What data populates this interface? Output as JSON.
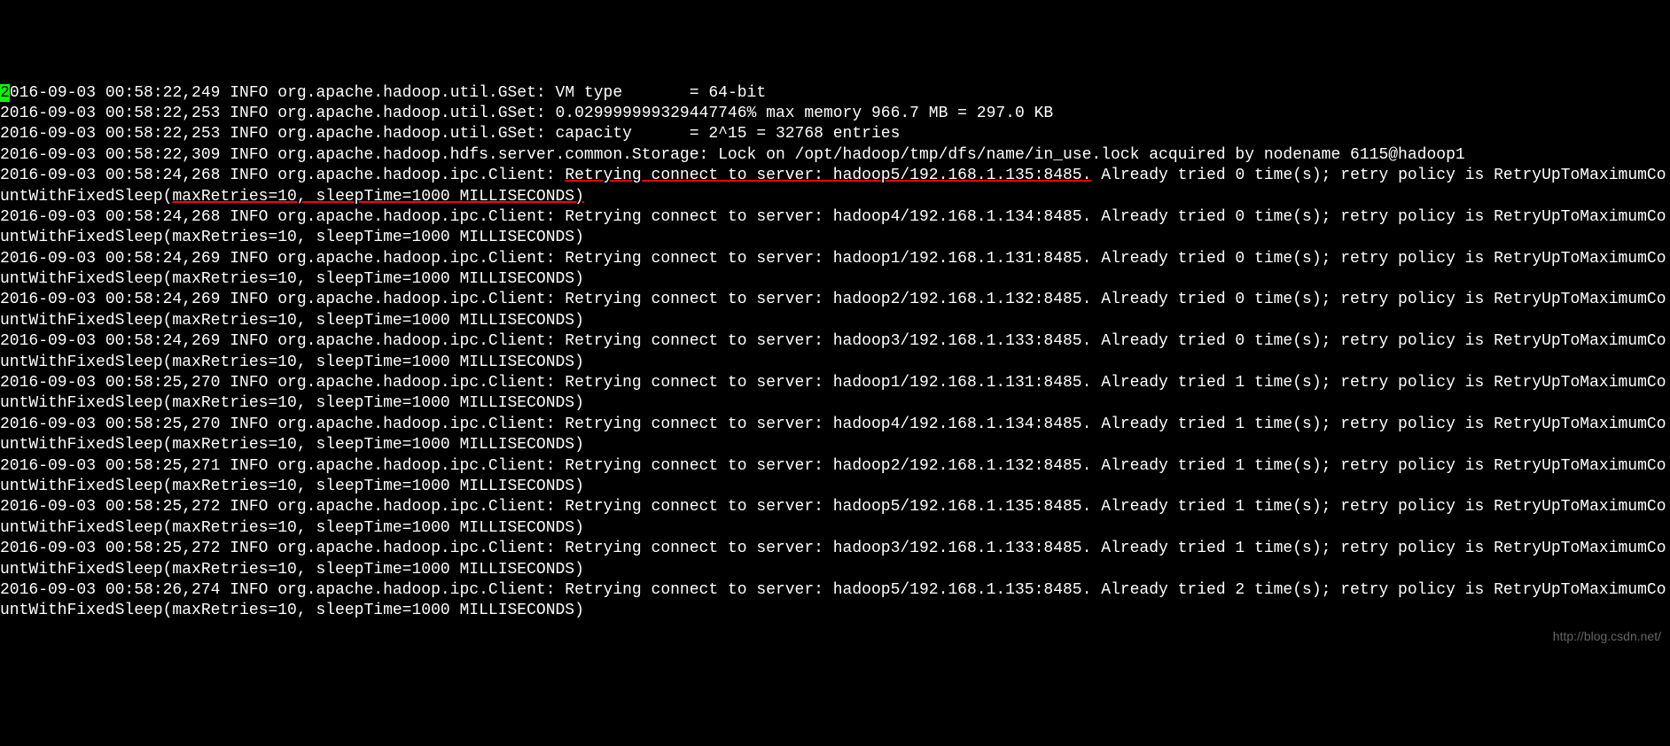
{
  "terminal": {
    "lines": [
      {
        "ts": "2016-09-03 00:58:22,249",
        "level": "INFO",
        "class": "org.apache.hadoop.util.GSet",
        "msg": "VM type       = 64-bit",
        "cursor": true
      },
      {
        "ts": "2016-09-03 00:58:22,253",
        "level": "INFO",
        "class": "org.apache.hadoop.util.GSet",
        "msg": "0.029999999329447746% max memory 966.7 MB = 297.0 KB"
      },
      {
        "ts": "2016-09-03 00:58:22,253",
        "level": "INFO",
        "class": "org.apache.hadoop.util.GSet",
        "msg": "capacity      = 2^15 = 32768 entries"
      },
      {
        "ts": "2016-09-03 00:58:22,309",
        "level": "INFO",
        "class": "org.apache.hadoop.hdfs.server.common.Storage",
        "msg": "Lock on /opt/hadoop/tmp/dfs/name/in_use.lock acquired by nodename 6115@hadoop1"
      },
      {
        "ts": "2016-09-03 00:58:24,268",
        "level": "INFO",
        "class": "org.apache.hadoop.ipc.Client",
        "msg": "Retrying connect to server: hadoop5/192.168.1.135:8485. Already tried 0 time(s); retry policy is RetryUpToMaximumCountWithFixedSleep(maxRetries=10, sleepTime=1000 MILLISECONDS)",
        "highlight": true
      },
      {
        "ts": "2016-09-03 00:58:24,268",
        "level": "INFO",
        "class": "org.apache.hadoop.ipc.Client",
        "msg": "Retrying connect to server: hadoop4/192.168.1.134:8485. Already tried 0 time(s); retry policy is RetryUpToMaximumCountWithFixedSleep(maxRetries=10, sleepTime=1000 MILLISECONDS)"
      },
      {
        "ts": "2016-09-03 00:58:24,269",
        "level": "INFO",
        "class": "org.apache.hadoop.ipc.Client",
        "msg": "Retrying connect to server: hadoop1/192.168.1.131:8485. Already tried 0 time(s); retry policy is RetryUpToMaximumCountWithFixedSleep(maxRetries=10, sleepTime=1000 MILLISECONDS)"
      },
      {
        "ts": "2016-09-03 00:58:24,269",
        "level": "INFO",
        "class": "org.apache.hadoop.ipc.Client",
        "msg": "Retrying connect to server: hadoop2/192.168.1.132:8485. Already tried 0 time(s); retry policy is RetryUpToMaximumCountWithFixedSleep(maxRetries=10, sleepTime=1000 MILLISECONDS)"
      },
      {
        "ts": "2016-09-03 00:58:24,269",
        "level": "INFO",
        "class": "org.apache.hadoop.ipc.Client",
        "msg": "Retrying connect to server: hadoop3/192.168.1.133:8485. Already tried 0 time(s); retry policy is RetryUpToMaximumCountWithFixedSleep(maxRetries=10, sleepTime=1000 MILLISECONDS)"
      },
      {
        "ts": "2016-09-03 00:58:25,270",
        "level": "INFO",
        "class": "org.apache.hadoop.ipc.Client",
        "msg": "Retrying connect to server: hadoop1/192.168.1.131:8485. Already tried 1 time(s); retry policy is RetryUpToMaximumCountWithFixedSleep(maxRetries=10, sleepTime=1000 MILLISECONDS)"
      },
      {
        "ts": "2016-09-03 00:58:25,270",
        "level": "INFO",
        "class": "org.apache.hadoop.ipc.Client",
        "msg": "Retrying connect to server: hadoop4/192.168.1.134:8485. Already tried 1 time(s); retry policy is RetryUpToMaximumCountWithFixedSleep(maxRetries=10, sleepTime=1000 MILLISECONDS)"
      },
      {
        "ts": "2016-09-03 00:58:25,271",
        "level": "INFO",
        "class": "org.apache.hadoop.ipc.Client",
        "msg": "Retrying connect to server: hadoop2/192.168.1.132:8485. Already tried 1 time(s); retry policy is RetryUpToMaximumCountWithFixedSleep(maxRetries=10, sleepTime=1000 MILLISECONDS)"
      },
      {
        "ts": "2016-09-03 00:58:25,272",
        "level": "INFO",
        "class": "org.apache.hadoop.ipc.Client",
        "msg": "Retrying connect to server: hadoop5/192.168.1.135:8485. Already tried 1 time(s); retry policy is RetryUpToMaximumCountWithFixedSleep(maxRetries=10, sleepTime=1000 MILLISECONDS)"
      },
      {
        "ts": "2016-09-03 00:58:25,272",
        "level": "INFO",
        "class": "org.apache.hadoop.ipc.Client",
        "msg": "Retrying connect to server: hadoop3/192.168.1.133:8485. Already tried 1 time(s); retry policy is RetryUpToMaximumCountWithFixedSleep(maxRetries=10, sleepTime=1000 MILLISECONDS)"
      },
      {
        "ts": "2016-09-03 00:58:26,274",
        "level": "INFO",
        "class": "org.apache.hadoop.ipc.Client",
        "msg": "Retrying connect to server: hadoop5/192.168.1.135:8485. Already tried 2 time(s); retry policy is RetryUpToMaximumCountWithFixedSleep(maxRetries=10, sleepTime=1000 MILLISECONDS)"
      }
    ]
  },
  "watermark": "http://blog.csdn.net/"
}
